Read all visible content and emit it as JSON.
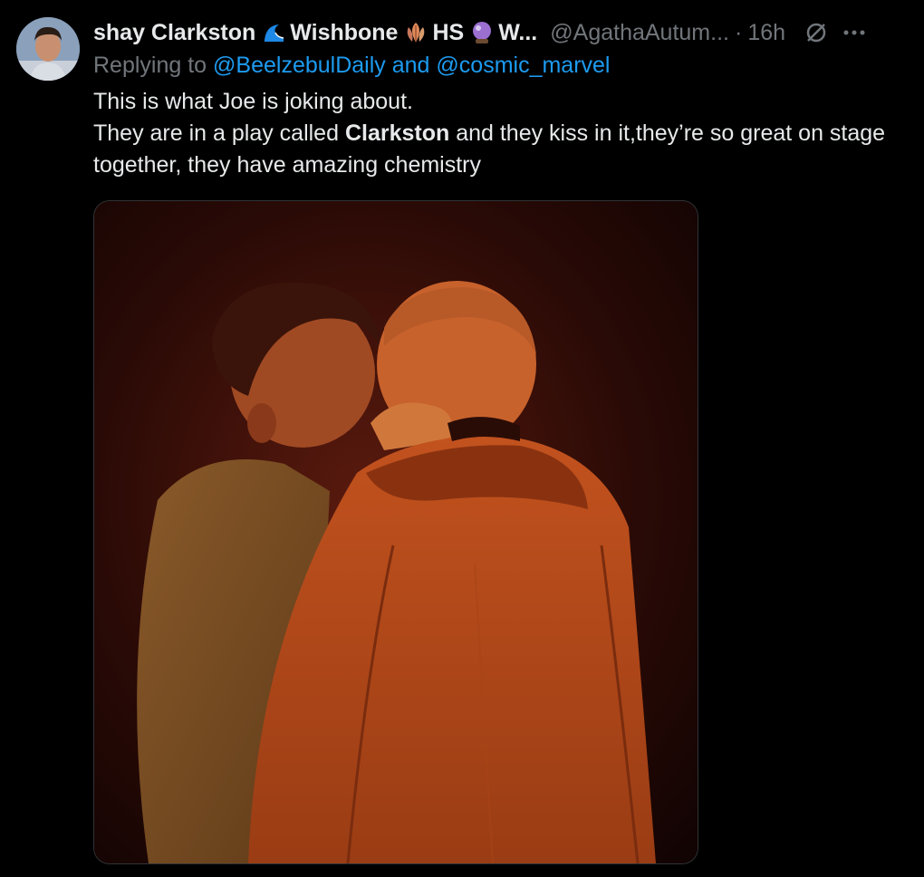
{
  "author": {
    "display_name_part1": "shay Clarkston",
    "display_name_part2": "Wishbone",
    "display_name_part3": "HS",
    "display_name_part4": "W...",
    "handle": "@AgathaAutum...",
    "separator": "·",
    "time": "16h",
    "avatar_icon": "avatar-photo",
    "emoji_icons": [
      "wave-icon",
      "leaf-icon",
      "crystal-ball-icon"
    ]
  },
  "reply": {
    "prefix": "Replying to",
    "mention1": "@BeelzebulDaily",
    "conjunction": "and",
    "mention2": "@cosmic_marvel"
  },
  "tweet": {
    "line1": "This is what Joe is joking about.",
    "line2_pre": "They are in a play called",
    "line2_bold": "Clarkston",
    "line2_post": "and they kiss in it,they’re so great on stage together, they have amazing chemistry"
  },
  "media": {
    "description_icon": "photo-two-actors-kissing-on-stage"
  },
  "colors": {
    "background": "#000000",
    "text": "#e7e9ea",
    "secondary": "#71767b",
    "link": "#1d9bf0"
  }
}
